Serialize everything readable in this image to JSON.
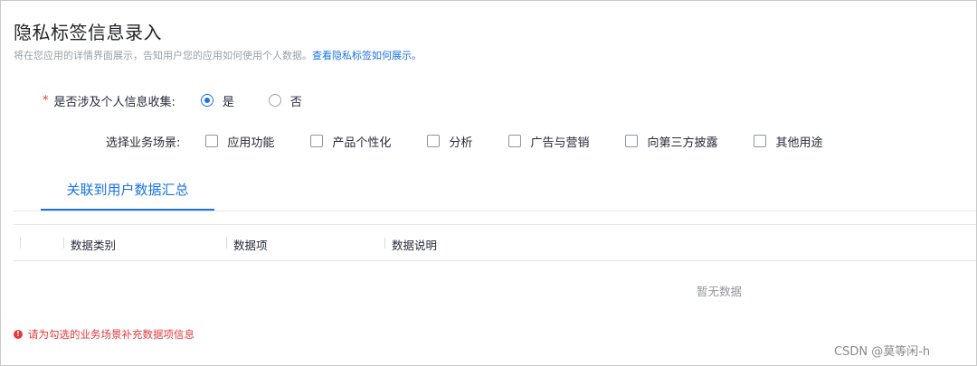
{
  "page": {
    "title": "隐私标签信息录入",
    "subtitle": "将在您应用的详情界面展示，告知用户您的应用如何使用个人数据。",
    "subtitle_link": "查看隐私标签如何展示。"
  },
  "question": {
    "required_mark": "*",
    "label": "是否涉及个人信息收集:",
    "options": [
      {
        "label": "是",
        "checked": true
      },
      {
        "label": "否",
        "checked": false
      }
    ]
  },
  "scenarios": {
    "label": "选择业务场景:",
    "options": [
      "应用功能",
      "产品个性化",
      "分析",
      "广告与营销",
      "向第三方披露",
      "其他用途"
    ]
  },
  "tab": {
    "label": "关联到用户数据汇总"
  },
  "table": {
    "columns": [
      "数据类别",
      "数据项",
      "数据说明"
    ],
    "empty_text": "暂无数据"
  },
  "error": {
    "icon": "error-icon",
    "message": "请为勾选的业务场景补充数据项信息"
  },
  "watermark": "CSDN @莫等闲-h",
  "colors": {
    "accent": "#1a73e8",
    "error": "#e6393b"
  }
}
